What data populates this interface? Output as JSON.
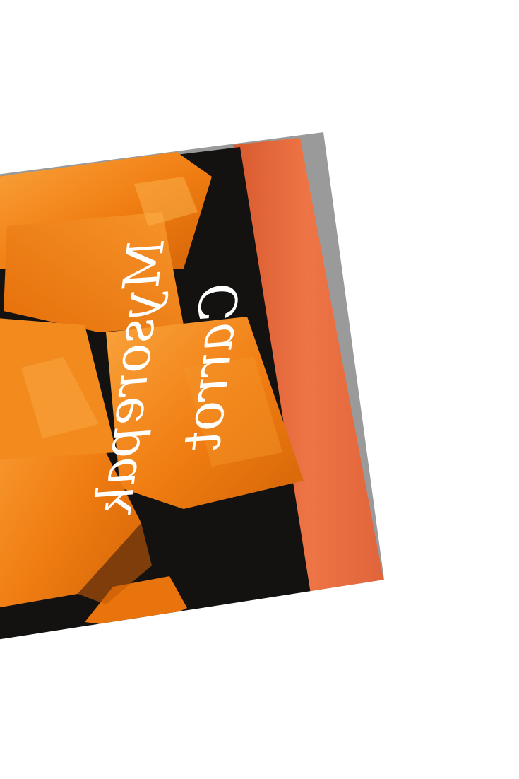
{
  "photo": {
    "subject": "carrot burfi pieces on a dark plate",
    "caption_line1": "Carrot",
    "caption_line2": "Mysorepak"
  },
  "colors": {
    "background": "#ffffff",
    "plate": "#141210",
    "carrot_fudge": "#f07d12",
    "carrot_highlight": "#f7a23a",
    "carrot_shadow": "#c45a06",
    "carrot_raw": "#e8693d",
    "table_grey": "#9a9a9a",
    "caption": "#ffffff"
  }
}
